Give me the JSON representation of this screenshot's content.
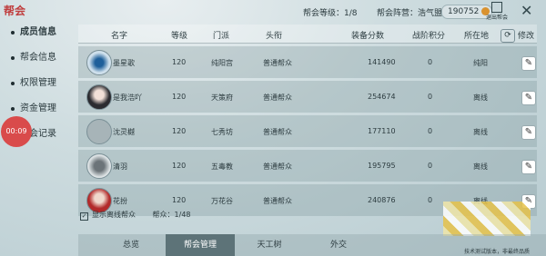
{
  "header": {
    "logo": "帮会",
    "level_label": "帮会等级：1/8",
    "camp_label": "帮会阵营：浩气盟",
    "currency": "190752",
    "exit_label": "退出帮会"
  },
  "sidebar": {
    "items": [
      {
        "label": "成员信息",
        "active": true
      },
      {
        "label": "帮会信息",
        "active": false
      },
      {
        "label": "权限管理",
        "active": false
      },
      {
        "label": "资金管理",
        "active": false
      },
      {
        "label": "帮会记录",
        "active": false
      }
    ],
    "timer": "00:09"
  },
  "table": {
    "headers": {
      "name": "名字",
      "level": "等级",
      "school": "门派",
      "title": "头衔",
      "score": "装备分数",
      "war": "战阶积分",
      "location": "所在地",
      "modify": "修改"
    },
    "rows": [
      {
        "name": "墨星歌",
        "level": "120",
        "school": "纯阳宫",
        "title": "普通帮众",
        "score": "141490",
        "war": "0",
        "location": "纯阳"
      },
      {
        "name": "是我浩吖",
        "level": "120",
        "school": "天策府",
        "title": "普通帮众",
        "score": "254674",
        "war": "0",
        "location": "离线"
      },
      {
        "name": "沈灵樾",
        "level": "120",
        "school": "七秀坊",
        "title": "普通帮众",
        "score": "177110",
        "war": "0",
        "location": "离线"
      },
      {
        "name": "清羽",
        "level": "120",
        "school": "五毒教",
        "title": "普通帮众",
        "score": "195795",
        "war": "0",
        "location": "离线"
      },
      {
        "name": "花扮",
        "level": "120",
        "school": "万花谷",
        "title": "普通帮众",
        "score": "240876",
        "war": "0",
        "location": "离线"
      }
    ]
  },
  "footer": {
    "show_offline_label": "显示离线帮众",
    "count_label": "帮众：1/48"
  },
  "tabs": [
    "总览",
    "帮会管理",
    "天工树",
    "外交"
  ],
  "note": "技术测试版本，非最终品质"
}
